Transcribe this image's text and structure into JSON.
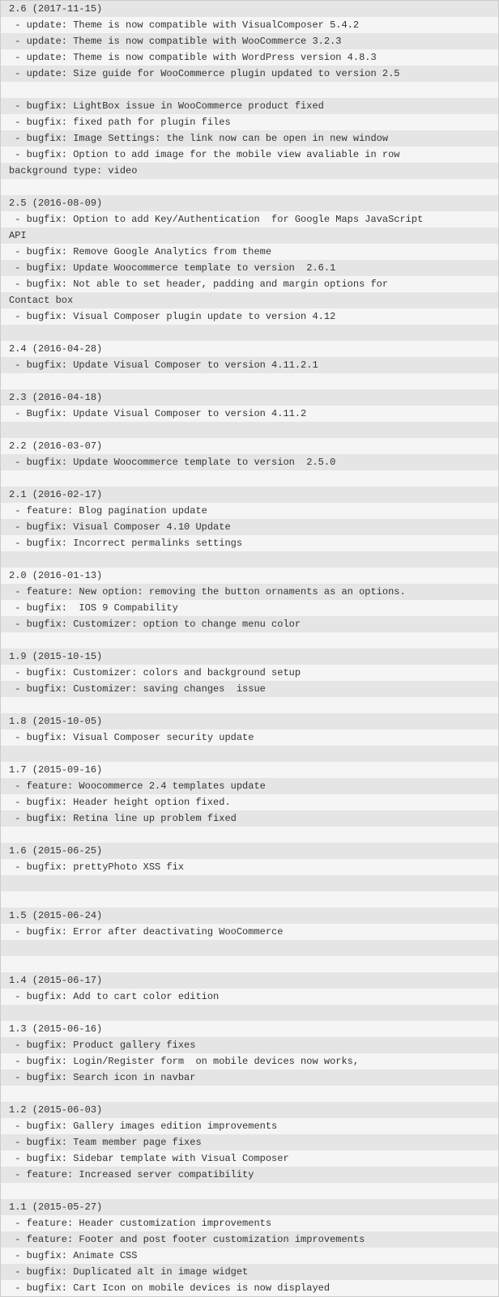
{
  "lines": [
    "2.6 (2017-11-15)",
    " - update: Theme is now compatible with VisualComposer 5.4.2",
    " - update: Theme is now compatible with WooCommerce 3.2.3",
    " - update: Theme is now compatible with WordPress version 4.8.3",
    " - update: Size guide for WooCommerce plugin updated to version 2.5",
    "",
    " - bugfix: LightBox issue in WooCommerce product fixed",
    " - bugfix: fixed path for plugin files",
    " - bugfix: Image Settings: the link now can be open in new window",
    " - bugfix: Option to add image for the mobile view avaliable in row",
    "background type: video",
    "",
    "2.5 (2016-08-09)",
    " - bugfix: Option to add Key/Authentication  for Google Maps JavaScript",
    "API",
    " - bugfix: Remove Google Analytics from theme",
    " - bugfix: Update Woocommerce template to version  2.6.1",
    " - bugfix: Not able to set header, padding and margin options for",
    "Contact box",
    " - bugfix: Visual Composer plugin update to version 4.12",
    "",
    "2.4 (2016-04-28)",
    " - bugfix: Update Visual Composer to version 4.11.2.1",
    "",
    "2.3 (2016-04-18)",
    " - Bugfix: Update Visual Composer to version 4.11.2",
    "",
    "2.2 (2016-03-07)",
    " - bugfix: Update Woocommerce template to version  2.5.0",
    "",
    "2.1 (2016-02-17)",
    " - feature: Blog pagination update",
    " - bugfix: Visual Composer 4.10 Update",
    " - bugfix: Incorrect permalinks settings",
    "",
    "2.0 (2016-01-13)",
    " - feature: New option: removing the button ornaments as an options.",
    " - bugfix:  IOS 9 Compability",
    " - bugfix: Customizer: option to change menu color",
    "",
    "1.9 (2015-10-15)",
    " - bugfix: Customizer: colors and background setup",
    " - bugfix: Customizer: saving changes  issue",
    "",
    "1.8 (2015-10-05)",
    " - bugfix: Visual Composer security update",
    "",
    "1.7 (2015-09-16)",
    " - feature: Woocommerce 2.4 templates update",
    " - bugfix: Header height option fixed.",
    " - bugfix: Retina line up problem fixed",
    "",
    "1.6 (2015-06-25)",
    " - bugfix: prettyPhoto XSS fix",
    "",
    "",
    "1.5 (2015-06-24)",
    " - bugfix: Error after deactivating WooCommerce",
    "",
    "",
    "1.4 (2015-06-17)",
    " - bugfix: Add to cart color edition",
    "",
    "1.3 (2015-06-16)",
    " - bugfix: Product gallery fixes",
    " - bugfix: Login/Register form  on mobile devices now works,",
    " - bugfix: Search icon in navbar",
    "",
    "1.2 (2015-06-03)",
    " - bugfix: Gallery images edition improvements",
    " - bugfix: Team member page fixes",
    " - bugfix: Sidebar template with Visual Composer",
    " - feature: Increased server compatibility",
    "",
    "1.1 (2015-05-27)",
    " - feature: Header customization improvements",
    " - feature: Footer and post footer customization improvements",
    " - bugfix: Animate CSS",
    " - bugfix: Duplicated alt in image widget",
    " - bugfix: Cart Icon on mobile devices is now displayed"
  ]
}
